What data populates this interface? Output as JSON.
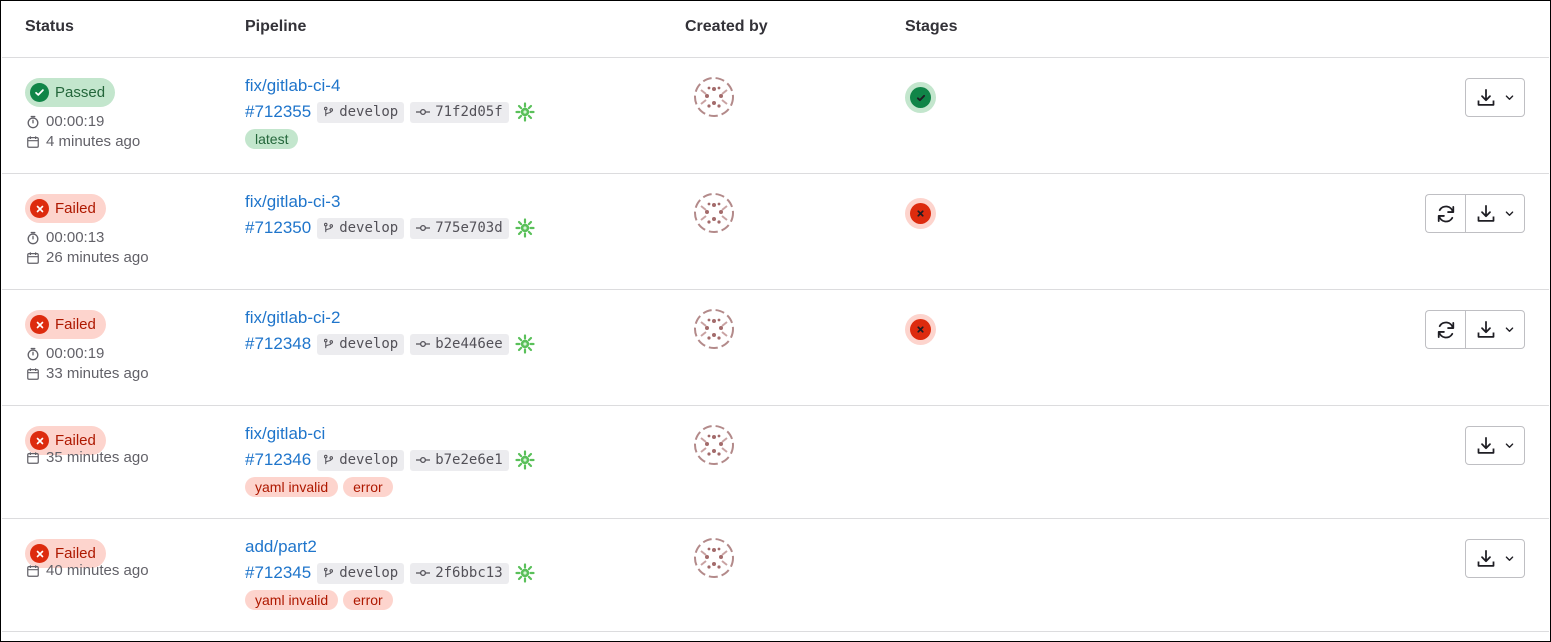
{
  "header": {
    "status": "Status",
    "pipeline": "Pipeline",
    "created_by": "Created by",
    "stages": "Stages"
  },
  "colors": {
    "link": "#1f75cb",
    "passed": "#108548",
    "failed": "#dd2b0e"
  },
  "rows": [
    {
      "status": "Passed",
      "duration": "00:00:19",
      "finished": "4 minutes ago",
      "name": "fix/gitlab-ci-4",
      "id": "#712355",
      "branch": "develop",
      "commit": "71f2d05f",
      "tags": [
        "latest"
      ],
      "stage": "passed"
    },
    {
      "status": "Failed",
      "duration": "00:00:13",
      "finished": "26 minutes ago",
      "name": "fix/gitlab-ci-3",
      "id": "#712350",
      "branch": "develop",
      "commit": "775e703d",
      "tags": [],
      "stage": "failed"
    },
    {
      "status": "Failed",
      "duration": "00:00:19",
      "finished": "33 minutes ago",
      "name": "fix/gitlab-ci-2",
      "id": "#712348",
      "branch": "develop",
      "commit": "b2e446ee",
      "tags": [],
      "stage": "failed"
    },
    {
      "status": "Failed",
      "duration": "",
      "finished": "35 minutes ago",
      "name": "fix/gitlab-ci",
      "id": "#712346",
      "branch": "develop",
      "commit": "b7e2e6e1",
      "tags": [
        "yaml invalid",
        "error"
      ],
      "stage": ""
    },
    {
      "status": "Failed",
      "duration": "",
      "finished": "40 minutes ago",
      "name": "add/part2",
      "id": "#712345",
      "branch": "develop",
      "commit": "2f6bbc13",
      "tags": [
        "yaml invalid",
        "error"
      ],
      "stage": ""
    }
  ]
}
